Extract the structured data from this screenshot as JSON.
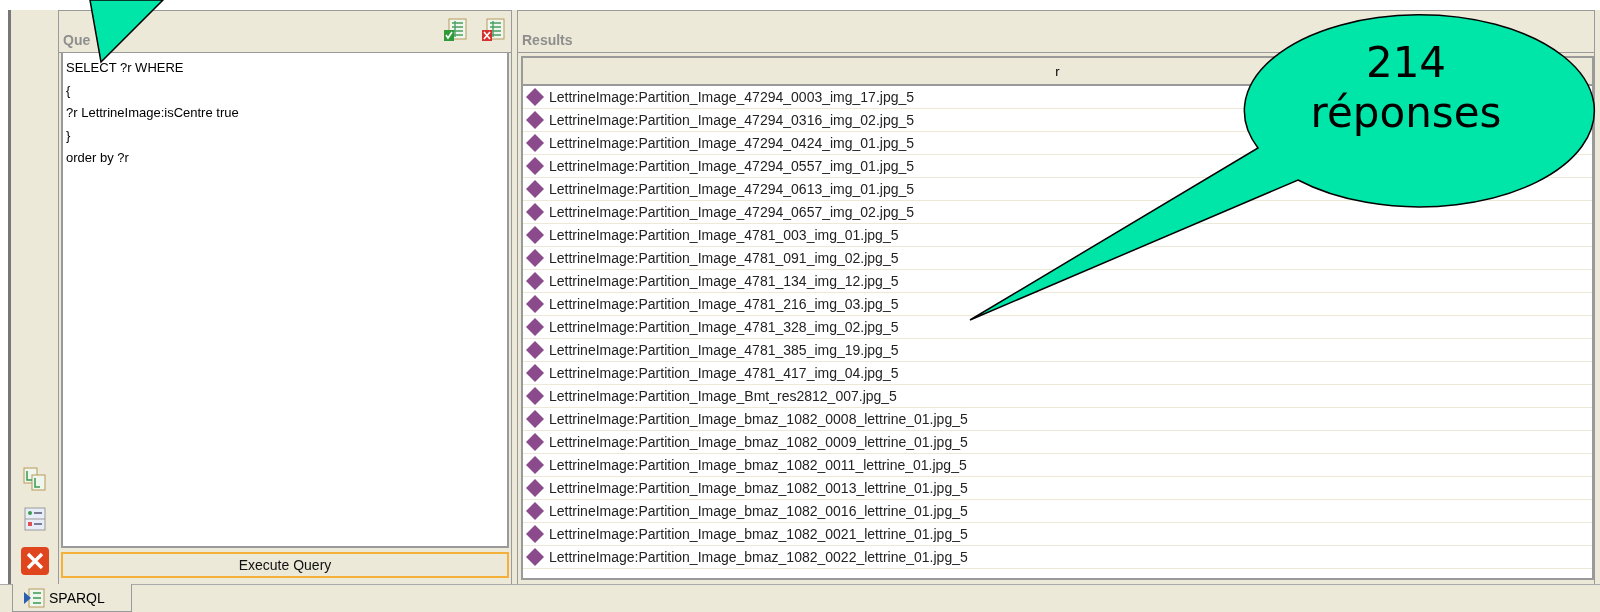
{
  "query_panel": {
    "title": "Que",
    "query_lines": [
      "SELECT ?r WHERE",
      "{",
      "?r LettrineImage:isCentre true",
      "}",
      "order by ?r"
    ],
    "execute_button": "Execute Query"
  },
  "results_panel": {
    "title": "Results",
    "columns": [
      "r"
    ],
    "rows": [
      "LettrineImage:Partition_Image_47294_0003_img_17.jpg_5",
      "LettrineImage:Partition_Image_47294_0316_img_02.jpg_5",
      "LettrineImage:Partition_Image_47294_0424_img_01.jpg_5",
      "LettrineImage:Partition_Image_47294_0557_img_01.jpg_5",
      "LettrineImage:Partition_Image_47294_0613_img_01.jpg_5",
      "LettrineImage:Partition_Image_47294_0657_img_02.jpg_5",
      "LettrineImage:Partition_Image_4781_003_img_01.jpg_5",
      "LettrineImage:Partition_Image_4781_091_img_02.jpg_5",
      "LettrineImage:Partition_Image_4781_134_img_12.jpg_5",
      "LettrineImage:Partition_Image_4781_216_img_03.jpg_5",
      "LettrineImage:Partition_Image_4781_328_img_02.jpg_5",
      "LettrineImage:Partition_Image_4781_385_img_19.jpg_5",
      "LettrineImage:Partition_Image_4781_417_img_04.jpg_5",
      "LettrineImage:Partition_Image_Bmt_res2812_007.jpg_5",
      "LettrineImage:Partition_Image_bmaz_1082_0008_lettrine_01.jpg_5",
      "LettrineImage:Partition_Image_bmaz_1082_0009_lettrine_01.jpg_5",
      "LettrineImage:Partition_Image_bmaz_1082_0011_lettrine_01.jpg_5",
      "LettrineImage:Partition_Image_bmaz_1082_0013_lettrine_01.jpg_5",
      "LettrineImage:Partition_Image_bmaz_1082_0016_lettrine_01.jpg_5",
      "LettrineImage:Partition_Image_bmaz_1082_0021_lettrine_01.jpg_5",
      "LettrineImage:Partition_Image_bmaz_1082_0022_lettrine_01.jpg_5"
    ]
  },
  "tabs": [
    {
      "label": "SPARQL",
      "selected": true
    }
  ],
  "callout": {
    "lines": [
      "214",
      "réponses"
    ]
  }
}
